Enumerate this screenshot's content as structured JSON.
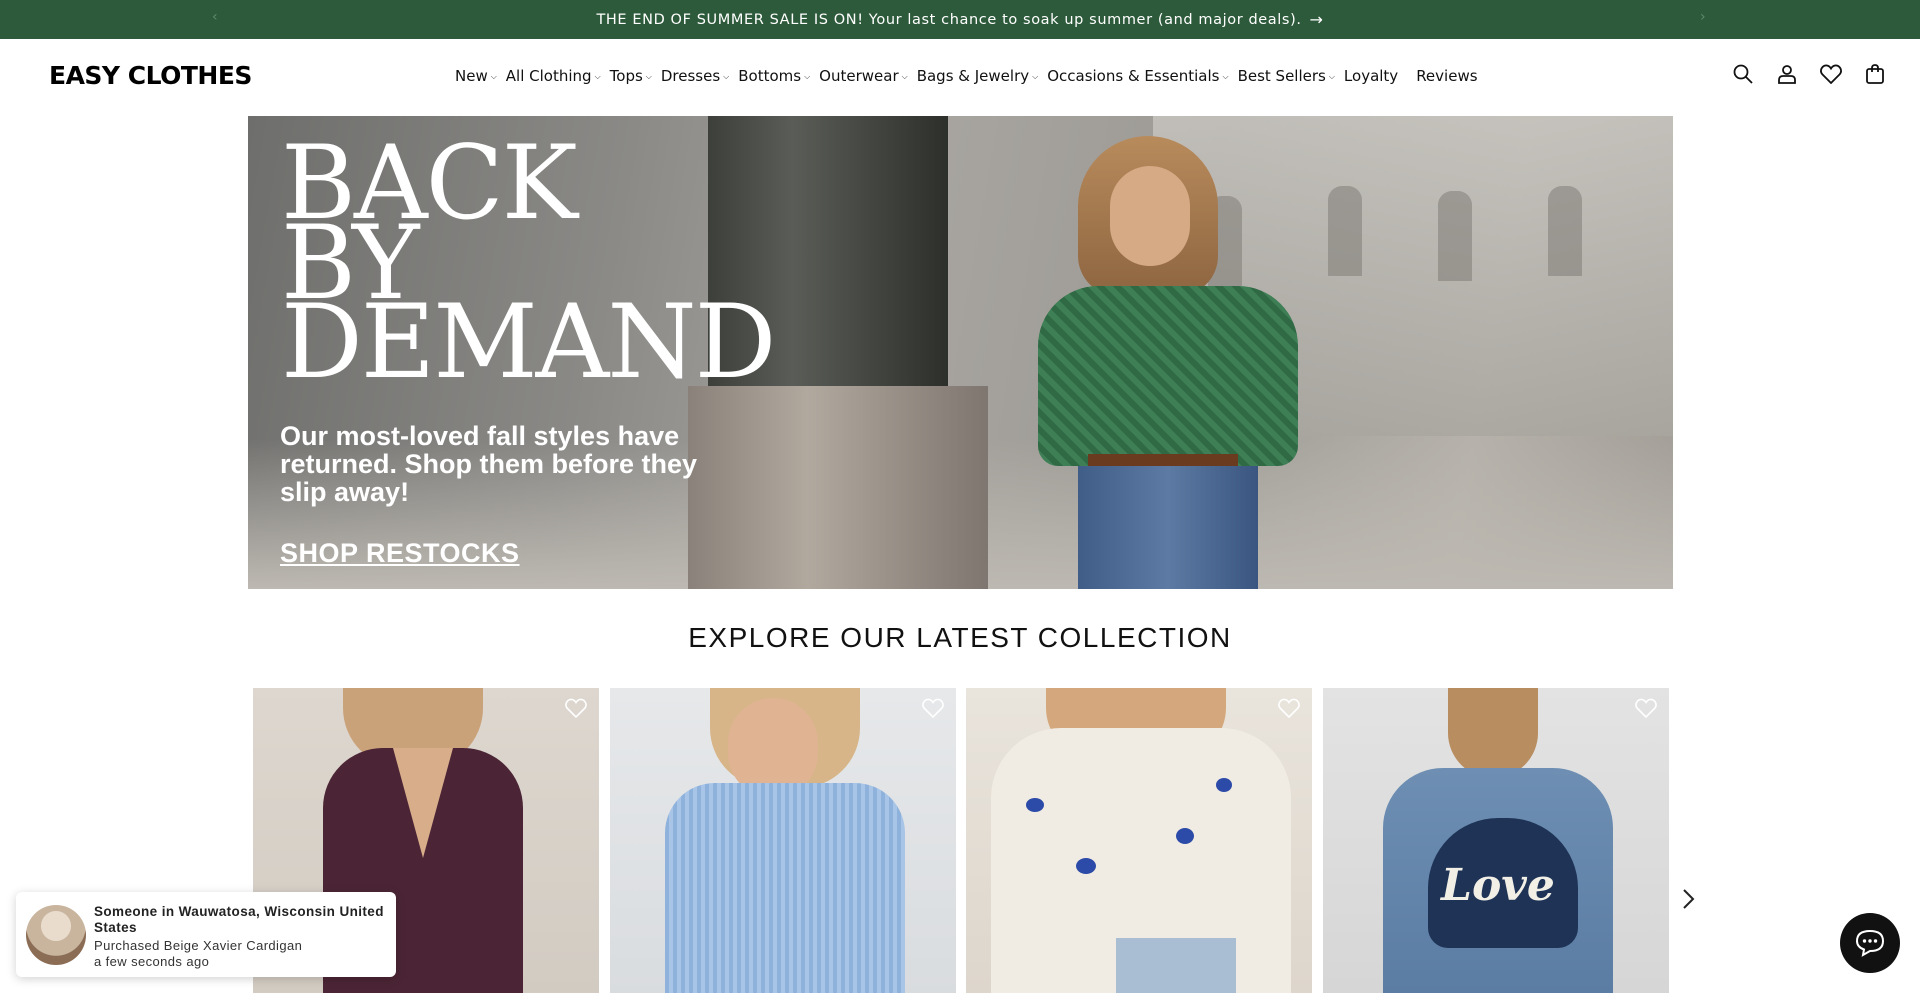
{
  "announcement": {
    "text": "THE END OF SUMMER SALE IS ON! Your last chance to soak up summer (and major deals).",
    "arrow": "→",
    "prev": "‹",
    "next": "›"
  },
  "header": {
    "logo": "EASY CLOTHES",
    "nav": [
      {
        "label": "New",
        "dropdown": true
      },
      {
        "label": "All Clothing",
        "dropdown": true
      },
      {
        "label": "Tops",
        "dropdown": true
      },
      {
        "label": "Dresses",
        "dropdown": true
      },
      {
        "label": "Bottoms",
        "dropdown": true
      },
      {
        "label": "Outerwear",
        "dropdown": true
      },
      {
        "label": "Bags & Jewelry",
        "dropdown": true
      },
      {
        "label": "Occasions & Essentials",
        "dropdown": true
      },
      {
        "label": "Best Sellers",
        "dropdown": true
      },
      {
        "label": "Loyalty",
        "dropdown": false
      },
      {
        "label": "Reviews",
        "dropdown": false
      }
    ],
    "icons": [
      "search-icon",
      "account-icon",
      "wishlist-heart-icon",
      "cart-bag-icon"
    ]
  },
  "hero": {
    "title_lines": [
      "BACK",
      "BY",
      "DEMAND"
    ],
    "subtitle": "Our most-loved fall styles have returned. Shop them before they slip away!",
    "cta": "SHOP RESTOCKS"
  },
  "collection": {
    "title": "EXPLORE OUR LATEST COLLECTION",
    "products": [
      {
        "icon": "wishlist-heart-icon"
      },
      {
        "icon": "wishlist-heart-icon"
      },
      {
        "icon": "wishlist-heart-icon"
      },
      {
        "icon": "wishlist-heart-icon"
      }
    ],
    "next_icon": "chevron-right-icon",
    "card4_text": "Love"
  },
  "toast": {
    "line1": "Someone in Wauwatosa, Wisconsin United States",
    "line2": "Purchased Beige Xavier Cardigan",
    "line3": "a few seconds ago"
  },
  "colors": {
    "announcement_bg": "#2d5a3a",
    "text": "#111111",
    "chat_bg": "#111111"
  }
}
